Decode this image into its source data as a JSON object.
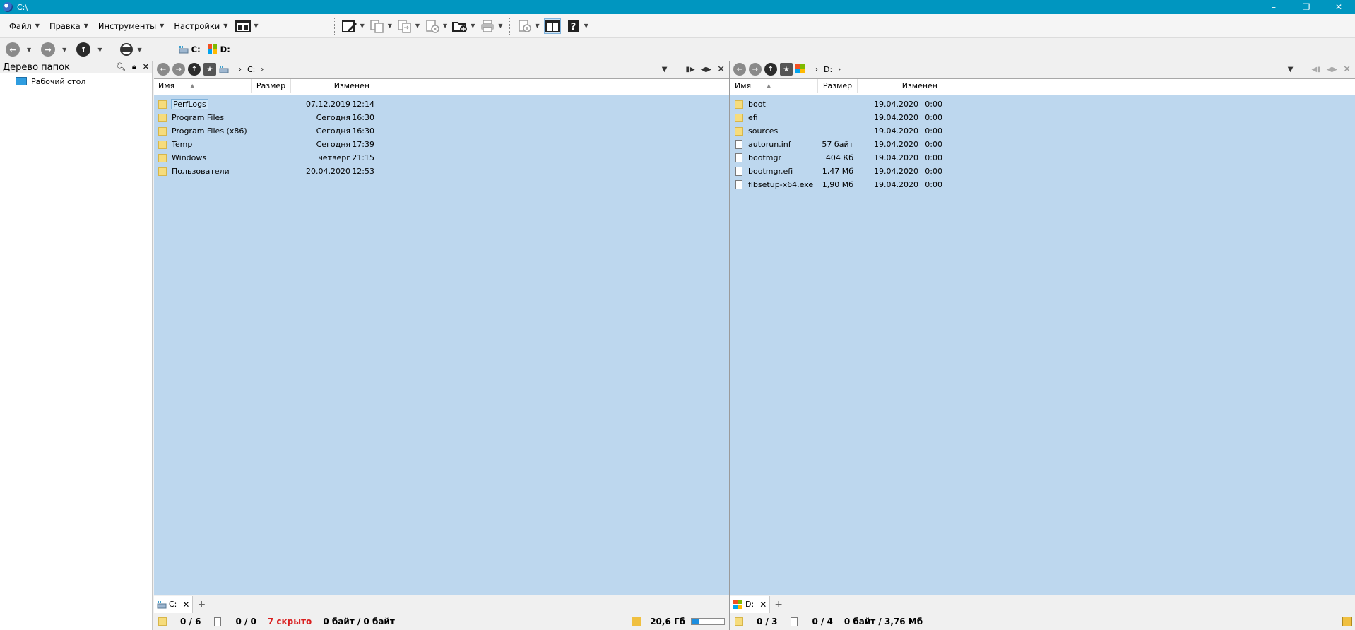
{
  "window": {
    "title": "C:\\"
  },
  "menu": [
    {
      "label": "Файл"
    },
    {
      "label": "Правка"
    },
    {
      "label": "Инструменты"
    },
    {
      "label": "Настройки"
    }
  ],
  "drives": [
    {
      "label": "C:",
      "icon": "hdd-icon"
    },
    {
      "label": "D:",
      "icon": "windows-drive-icon"
    }
  ],
  "sidebar": {
    "title": "Дерево папок",
    "items": [
      {
        "label": "Рабочий стол"
      }
    ]
  },
  "columns": {
    "name": "Имя",
    "size": "Размер",
    "modified": "Изменен"
  },
  "left_panel": {
    "path": "C:",
    "tab": "C:",
    "rows": [
      {
        "name": "PerfLogs",
        "size": "",
        "date": "07.12.2019",
        "time": "12:14",
        "type": "folder"
      },
      {
        "name": "Program Files",
        "size": "",
        "date": "Сегодня",
        "time": "16:30",
        "type": "folder"
      },
      {
        "name": "Program Files (x86)",
        "size": "",
        "date": "Сегодня",
        "time": "16:30",
        "type": "folder"
      },
      {
        "name": "Temp",
        "size": "",
        "date": "Сегодня",
        "time": "17:39",
        "type": "folder"
      },
      {
        "name": "Windows",
        "size": "",
        "date": "четверг",
        "time": "21:15",
        "type": "folder"
      },
      {
        "name": "Пользователи",
        "size": "",
        "date": "20.04.2020",
        "time": "12:53",
        "type": "folder"
      }
    ],
    "status": {
      "folders": "0 / 6",
      "files": "0 / 0",
      "hidden": "7 скрыто",
      "bytes": "0 байт / 0 байт",
      "free": "20,6 Гб",
      "used_fraction": 0.22
    }
  },
  "right_panel": {
    "path": "D:",
    "tab": "D:",
    "rows": [
      {
        "name": "boot",
        "size": "",
        "date": "19.04.2020",
        "time": "0:00",
        "type": "folder"
      },
      {
        "name": "efi",
        "size": "",
        "date": "19.04.2020",
        "time": "0:00",
        "type": "folder"
      },
      {
        "name": "sources",
        "size": "",
        "date": "19.04.2020",
        "time": "0:00",
        "type": "folder"
      },
      {
        "name": "autorun.inf",
        "size": "57 байт",
        "date": "19.04.2020",
        "time": "0:00",
        "type": "file"
      },
      {
        "name": "bootmgr",
        "size": "404 Кб",
        "date": "19.04.2020",
        "time": "0:00",
        "type": "file"
      },
      {
        "name": "bootmgr.efi",
        "size": "1,47 Мб",
        "date": "19.04.2020",
        "time": "0:00",
        "type": "file"
      },
      {
        "name": "flbsetup-x64.exe",
        "size": "1,90 Мб",
        "date": "19.04.2020",
        "time": "0:00",
        "type": "file"
      }
    ],
    "status": {
      "folders": "0 / 3",
      "files": "0 / 4",
      "bytes": "0 байт / 3,76 Мб"
    }
  },
  "colors": {
    "titlebar": "#0096c0",
    "selection": "#bdd7ee",
    "hidden_count": "#d92020"
  }
}
